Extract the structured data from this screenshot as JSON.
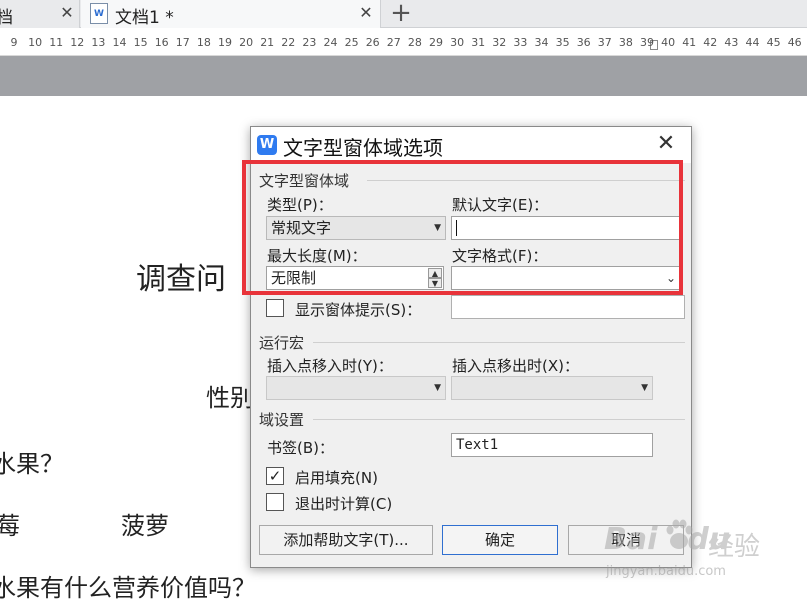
{
  "tabs": [
    {
      "title": "档",
      "close_glyph": "✕"
    },
    {
      "title": "文档1 *",
      "close_glyph": "✕"
    }
  ],
  "add_tab_glyph": "+",
  "ruler": {
    "numbers": [
      "9",
      "10",
      "11",
      "12",
      "13",
      "14",
      "15",
      "16",
      "17",
      "18",
      "19",
      "20",
      "21",
      "22",
      "23",
      "24",
      "25",
      "26",
      "27",
      "28",
      "29",
      "30",
      "31",
      "32",
      "33",
      "34",
      "35",
      "36",
      "37",
      "38",
      "39",
      "40",
      "41",
      "42",
      "43",
      "44",
      "45",
      "46"
    ]
  },
  "document": {
    "title_fragment": "调查问",
    "gender_fragment": "性别",
    "line1": "水果？",
    "fruit1": "莓",
    "fruit2": "菠萝",
    "line2": "水果有什么营养价值吗？"
  },
  "dialog": {
    "title": "文字型窗体域选项",
    "close_glyph": "✕",
    "app_icon": "W",
    "section_textfield": "文字型窗体域",
    "type_label": "类型(P)：",
    "type_value": "常规文字",
    "default_text_label": "默认文字(E)：",
    "default_text_value": "",
    "max_length_label": "最大长度(M)：",
    "max_length_value": "无限制",
    "text_format_label": "文字格式(F)：",
    "text_format_value": "",
    "show_tip_label": "显示窗体提示(S)：",
    "show_tip_checked": false,
    "show_tip_value": "",
    "section_macro": "运行宏",
    "entry_macro_label": "插入点移入时(Y)：",
    "exit_macro_label": "插入点移出时(X)：",
    "section_field": "域设置",
    "bookmark_label": "书签(B)：",
    "bookmark_value": "Text1",
    "fill_in_label": "启用填充(N)",
    "fill_in_checked": true,
    "calc_on_exit_label": "退出时计算(C)",
    "calc_on_exit_checked": false,
    "help_text_button": "添加帮助文字(T)...",
    "ok_button": "确定",
    "cancel_button": "取消"
  },
  "watermark": {
    "brand": "Bai",
    "brand_suffix": "du",
    "cn": "经验",
    "url": "jingyan.baidu.com"
  },
  "colors": {
    "highlight_box": "#e8333a",
    "app_icon_bg": "#2f7bf0",
    "default_button_border": "#2f6fd0"
  }
}
